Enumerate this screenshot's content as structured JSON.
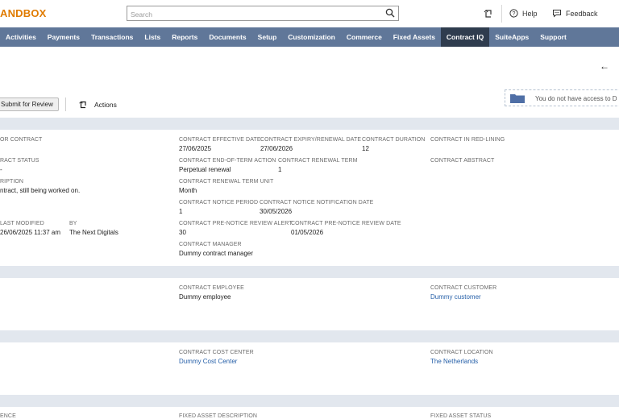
{
  "header": {
    "brand": "ANDBOX",
    "search_placeholder": "Search",
    "help_label": "Help",
    "feedback_label": "Feedback"
  },
  "nav": {
    "items": [
      "Activities",
      "Payments",
      "Transactions",
      "Lists",
      "Reports",
      "Documents",
      "Setup",
      "Customization",
      "Commerce",
      "Fixed Assets",
      "Contract IQ",
      "SuiteApps",
      "Support"
    ],
    "active": "Contract IQ"
  },
  "toolbar": {
    "submit_label": "Submit for Review",
    "actions_label": "Actions",
    "access_notice": "You do not have access to D"
  },
  "primary": {
    "f1_label": "OR CONTRACT",
    "status_label": "RACT STATUS",
    "status_value": "-",
    "desc_label": "RIPTION",
    "desc_value": "ntract, still being worked on.",
    "modified_label": "LAST MODIFIED",
    "modified_value": "26/06/2025 11:37 am",
    "by_label": "BY",
    "by_value": "The Next Digitals",
    "effective_label": "CONTRACT EFFECTIVE DATE",
    "effective_value": "27/06/2025",
    "expiry_label": "CONTRACT EXPIRY/RENEWAL DATE",
    "expiry_value": "27/06/2026",
    "duration_label": "CONTRACT DURATION",
    "duration_value": "12",
    "redlining_label": "CONTRACT IN RED-LINING",
    "eot_label": "CONTRACT END-OF-TERM ACTION",
    "eot_value": "Perpetual renewal",
    "renewal_term_label": "CONTRACT RENEWAL TERM",
    "renewal_term_value": "1",
    "abstract_label": "CONTRACT ABSTRACT",
    "term_unit_label": "CONTRACT RENEWAL TERM UNIT",
    "term_unit_value": "Month",
    "notice_period_label": "CONTRACT NOTICE PERIOD",
    "notice_period_value": "1",
    "notice_date_label": "CONTRACT NOTICE NOTIFICATION DATE",
    "notice_date_value": "30/05/2026",
    "prenotice_alert_label": "CONTRACT PRE-NOTICE REVIEW ALERT",
    "prenotice_alert_value": "30",
    "prenotice_date_label": "CONTRACT PRE-NOTICE REVIEW DATE",
    "prenotice_date_value": "01/05/2026",
    "manager_label": "CONTRACT MANAGER",
    "manager_value": "Dummy contract manager"
  },
  "parties": {
    "employee_label": "CONTRACT EMPLOYEE",
    "employee_value": "Dummy employee",
    "customer_label": "CONTRACT CUSTOMER",
    "customer_value": "Dummy customer"
  },
  "classification": {
    "cost_center_label": "CONTRACT COST CENTER",
    "cost_center_value": "Dummy Cost Center",
    "location_label": "CONTRACT LOCATION",
    "location_value": "The Netherlands"
  },
  "fixed_asset": {
    "ref_label": "ENCE",
    "desc_label": "FIXED ASSET DESCRIPTION",
    "status_label": "FIXED ASSET STATUS"
  }
}
